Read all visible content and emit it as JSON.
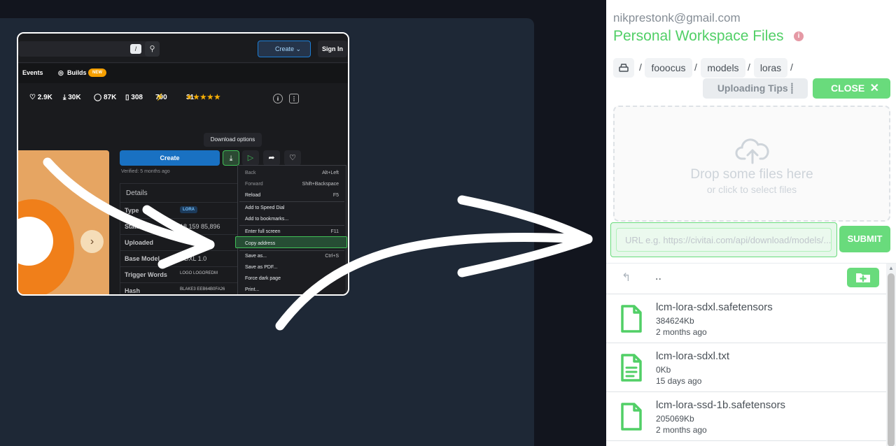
{
  "screenshot": {
    "search_shortcut": "/",
    "create_label": "Create",
    "signin_label": "Sign In",
    "nav": {
      "events": "Events",
      "builds": "Builds",
      "new_badge": "NEW"
    },
    "stats": {
      "likes": "2.9K",
      "downloads": "30K",
      "stat3": "87K",
      "bookmarks": "308",
      "bolt": "700",
      "stars": "★★★★★",
      "reviews": "31"
    },
    "tooltip": "Download options",
    "main_create": "Create",
    "verified": "Verified: 5 months ago",
    "details_title": "Details",
    "details": [
      {
        "key": "Type",
        "value": "LORA"
      },
      {
        "key": "Stats",
        "value": "18,159   85,896"
      },
      {
        "key": "Uploaded",
        "value": ""
      },
      {
        "key": "Base Model",
        "value": "SDXL 1.0"
      },
      {
        "key": "Trigger Words",
        "value": "LOGO   LOGOREDM"
      },
      {
        "key": "Hash",
        "value": "BLAKE3   EEB64B0FA26"
      }
    ],
    "context_menu": [
      {
        "label": "Back",
        "shortcut": "Alt+Left",
        "dim": true
      },
      {
        "label": "Forward",
        "shortcut": "Shift+Backspace",
        "dim": true
      },
      {
        "label": "Reload",
        "shortcut": "F5"
      },
      {
        "label": "Add to Speed Dial",
        "shortcut": ""
      },
      {
        "label": "Add to bookmarks...",
        "shortcut": ""
      },
      {
        "label": "Enter full screen",
        "shortcut": "F11"
      },
      {
        "label": "Copy address",
        "shortcut": ""
      },
      {
        "label": "Save as...",
        "shortcut": "Ctrl+S"
      },
      {
        "label": "Save as PDF...",
        "shortcut": ""
      },
      {
        "label": "Force dark page",
        "shortcut": ""
      },
      {
        "label": "Print...",
        "shortcut": ""
      }
    ]
  },
  "workspace": {
    "email": "nikprestonk@gmail.com",
    "title": "Personal Workspace Files",
    "breadcrumbs": [
      "fooocus",
      "models",
      "loras"
    ],
    "uploading_tips": "Uploading Tips",
    "close_label": "CLOSE",
    "drop_text": "Drop some files here",
    "drop_subtext": "or click to select files",
    "url_placeholder": "URL e.g. https://civitai.com/api/download/models/...",
    "submit_label": "SUBMIT",
    "parent_dir": "..",
    "files": [
      {
        "name": "lcm-lora-sdxl.safetensors",
        "size": "384624Kb",
        "date": "2 months ago",
        "type": "binary"
      },
      {
        "name": "lcm-lora-sdxl.txt",
        "size": "0Kb",
        "date": "15 days ago",
        "type": "text"
      },
      {
        "name": "lcm-lora-ssd-1b.safetensors",
        "size": "205069Kb",
        "date": "2 months ago",
        "type": "binary"
      }
    ]
  },
  "colors": {
    "accent_green": "#69db7c",
    "title_green": "#51cf66",
    "dark_bg": "#1e2836"
  }
}
